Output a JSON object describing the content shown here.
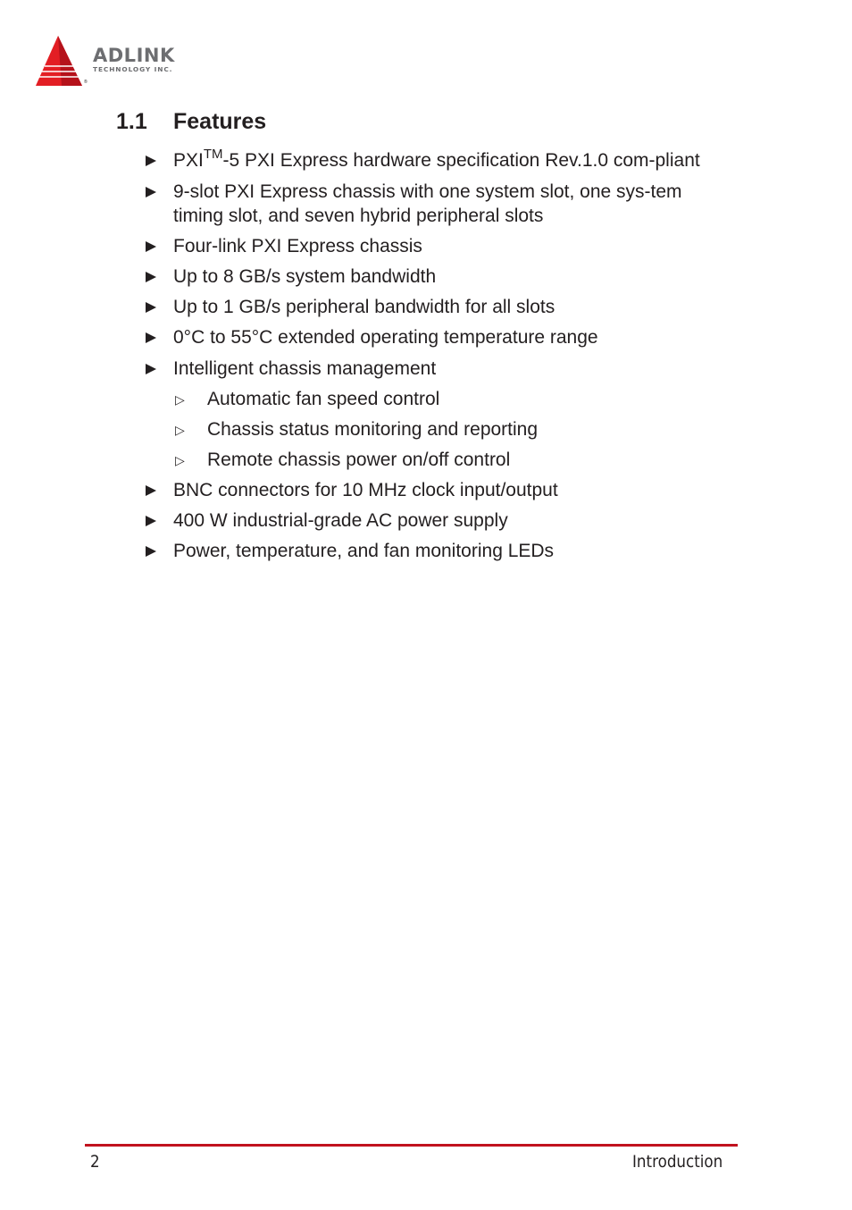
{
  "header": {
    "logo": {
      "brand": "ADLINK",
      "tagline": "TECHNOLOGY INC.",
      "registered": "®",
      "brand_color": "#e31e24",
      "text_color": "#6d6e71"
    }
  },
  "section": {
    "number": "1.1",
    "title": "Features"
  },
  "features": [
    {
      "text_prefix": "PXI",
      "superscript": "TM",
      "text": "-5 PXI Express hardware specification Rev.1.0 com-pliant"
    },
    {
      "text": "9-slot PXI Express chassis with one system slot, one sys-tem timing slot, and seven hybrid peripheral slots"
    },
    {
      "text": "Four-link PXI Express chassis"
    },
    {
      "text": "Up to 8 GB/s system bandwidth"
    },
    {
      "text": "Up to 1 GB/s peripheral bandwidth for all slots"
    },
    {
      "text": "0°C to 55°C extended operating temperature range"
    },
    {
      "text": "Intelligent chassis management",
      "subitems": [
        "Automatic fan speed control",
        "Chassis status monitoring and reporting",
        "Remote chassis power on/off control"
      ]
    },
    {
      "text": "BNC connectors for 10 MHz clock input/output"
    },
    {
      "text": "400 W industrial-grade AC power supply"
    },
    {
      "text": "Power, temperature, and fan monitoring LEDs"
    }
  ],
  "footer": {
    "page_number": "2",
    "section_name": "Introduction",
    "rule_color": "#c1121f"
  }
}
